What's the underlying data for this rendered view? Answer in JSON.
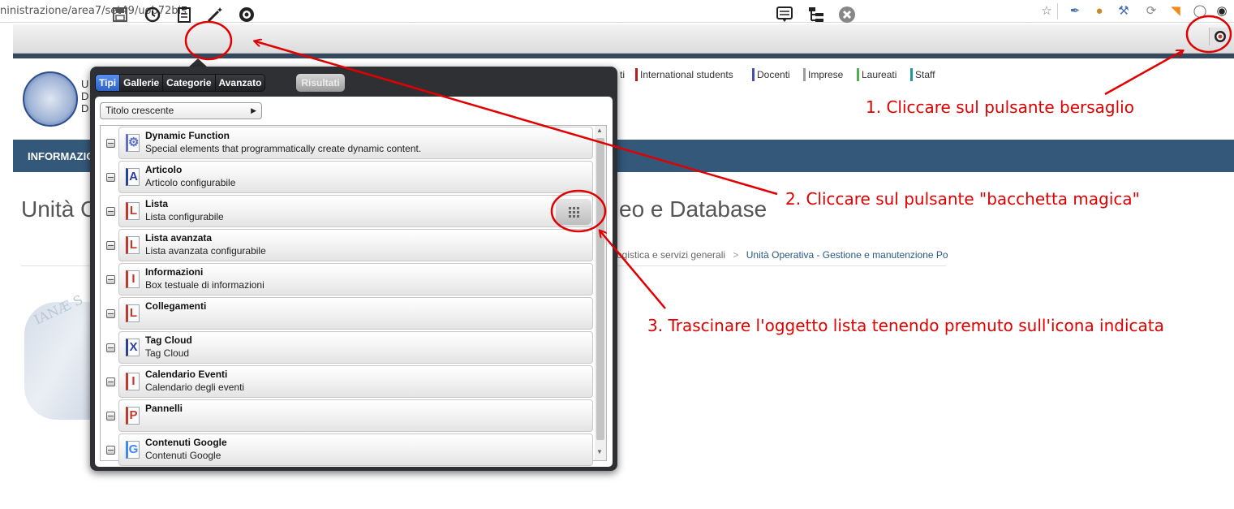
{
  "browser": {
    "url": "ninistrazione/area7/set49/uob72bis"
  },
  "site": {
    "nav_links": [
      {
        "label": "ti",
        "color": "#ffffff"
      },
      {
        "label": "International students",
        "color": "#b71c1c"
      },
      {
        "label": "Docenti",
        "color": "#3f51b5"
      },
      {
        "label": "Imprese",
        "color": "#9e9e9e"
      },
      {
        "label": "Laureati",
        "color": "#4caf50"
      },
      {
        "label": "Staff",
        "color": "#2196a5"
      }
    ],
    "logo_letters": "U\nD\nD",
    "bluebar_text": "INFORMAZIO",
    "page_title_start": "Unità O",
    "page_title_end": "eo e Database",
    "breadcrumb_part1": "ogistica e servizi generali",
    "breadcrumb_sep": ">",
    "breadcrumb_part2": "Unità Operativa - Gestione e manutenzione Po",
    "watermark_text": "IANÆ S"
  },
  "popup": {
    "tabs": [
      "Tipi",
      "Gallerie",
      "Categorie",
      "Avanzato"
    ],
    "active_tab": "Tipi",
    "results_button": "Risultati",
    "sort_value": "Titolo crescente",
    "items": [
      {
        "title": "Dynamic Function",
        "desc": "Special elements that programmatically create dynamic content.",
        "icon": "gear-doc-icon",
        "glyph": "⚙",
        "color": "#5a6fd0"
      },
      {
        "title": "Articolo",
        "desc": "Articolo configurabile",
        "icon": "article-icon",
        "glyph": "A",
        "color": "#2a3f9e"
      },
      {
        "title": "Lista",
        "desc": "Lista configurabile",
        "icon": "list-icon",
        "glyph": "L",
        "color": "#c0392b"
      },
      {
        "title": "Lista avanzata",
        "desc": "Lista avanzata configurabile",
        "icon": "list-advanced-icon",
        "glyph": "L",
        "color": "#c0392b"
      },
      {
        "title": "Informazioni",
        "desc": "Box testuale di informazioni",
        "icon": "info-icon",
        "glyph": "I",
        "color": "#c0392b"
      },
      {
        "title": "Collegamenti",
        "desc": "",
        "icon": "links-icon",
        "glyph": "L",
        "color": "#c0392b"
      },
      {
        "title": "Tag Cloud",
        "desc": "Tag Cloud",
        "icon": "tagcloud-icon",
        "glyph": "X",
        "color": "#2a3f9e"
      },
      {
        "title": "Calendario Eventi",
        "desc": "Calendario degli eventi",
        "icon": "calendar-icon",
        "glyph": "I",
        "color": "#c0392b"
      },
      {
        "title": "Pannelli",
        "desc": "",
        "icon": "panels-icon",
        "glyph": "P",
        "color": "#c0392b"
      },
      {
        "title": "Contenuti Google",
        "desc": "Contenuti Google",
        "icon": "google-icon",
        "glyph": "G",
        "color": "#4285f4"
      }
    ]
  },
  "annotations": {
    "step1": "1. Cliccare sul pulsante bersaglio",
    "step2": "2. Cliccare sul pulsante \"bacchetta magica\"",
    "step3": "3. Trascinare l'oggetto lista tenendo premuto sull'icona indicata",
    "color": "#e00000"
  }
}
